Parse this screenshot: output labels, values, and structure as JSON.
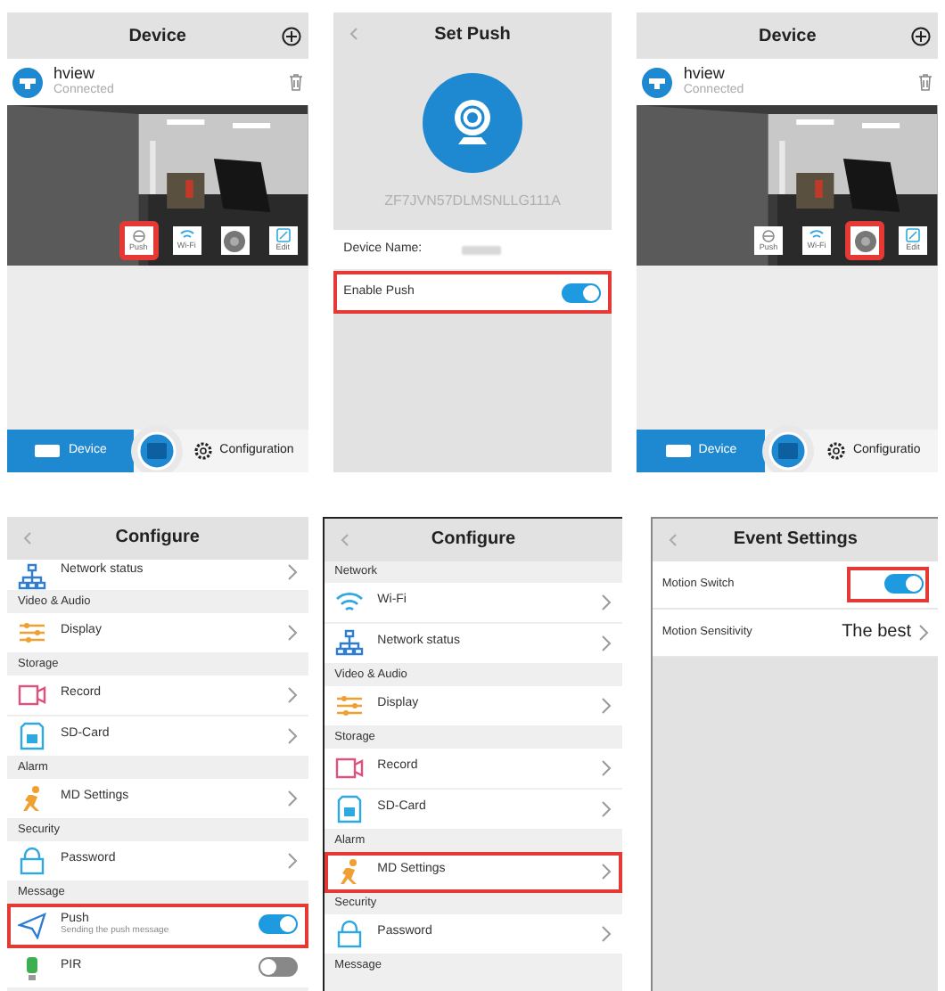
{
  "panels": [
    {
      "kind": "device",
      "title": "Device",
      "device": {
        "name": "hview",
        "status": "Connected"
      },
      "actions": [
        {
          "kind": "push",
          "label": "Push",
          "highlighted": true
        },
        {
          "kind": "wifi",
          "label": "Wi-Fi",
          "highlighted": false
        },
        {
          "kind": "settings",
          "highlighted": false
        },
        {
          "kind": "edit",
          "label": "Edit",
          "highlighted": false
        }
      ],
      "nav": [
        {
          "label": "Device",
          "selected": true
        },
        {
          "label": "Configuration",
          "selected": false
        }
      ]
    },
    {
      "kind": "set_push",
      "title": "Set Push",
      "device_id": "ZF7JVN57DLMSNLLG111A",
      "device_name_label": "Device Name:",
      "toggles": [
        {
          "label": "Enable Push",
          "on": true,
          "highlighted": true
        }
      ]
    },
    {
      "kind": "device",
      "title": "Device",
      "device": {
        "name": "hview",
        "status": "Connected"
      },
      "actions": [
        {
          "kind": "push",
          "label": "Push",
          "highlighted": false
        },
        {
          "kind": "wifi",
          "label": "Wi-Fi",
          "highlighted": false
        },
        {
          "kind": "settings",
          "highlighted": true
        },
        {
          "kind": "edit",
          "label": "Edit",
          "highlighted": false
        }
      ],
      "nav": [
        {
          "label": "Device",
          "selected": true
        },
        {
          "label": "Configuratio",
          "selected": false
        }
      ]
    },
    {
      "kind": "configure",
      "title": "Configure",
      "rows": [
        {
          "kind": "item",
          "label": "Network status",
          "highlighted": false
        },
        {
          "kind": "header",
          "label": "Video & Audio"
        },
        {
          "kind": "item",
          "label": "Display",
          "highlighted": false
        },
        {
          "kind": "header",
          "label": "Storage"
        },
        {
          "kind": "item",
          "label": "Record",
          "highlighted": false
        },
        {
          "kind": "item",
          "label": "SD-Card",
          "highlighted": false
        },
        {
          "kind": "header",
          "label": "Alarm"
        },
        {
          "kind": "item",
          "label": "MD Settings",
          "highlighted": false
        },
        {
          "kind": "header",
          "label": "Security"
        },
        {
          "kind": "item",
          "label": "Password",
          "highlighted": false
        },
        {
          "kind": "header",
          "label": "Message"
        },
        {
          "kind": "toggle",
          "label": "Push",
          "sublabel": "Sending the push message",
          "on": true,
          "highlighted": true
        },
        {
          "kind": "toggle",
          "label": "PIR",
          "on": false,
          "highlighted": false
        }
      ]
    },
    {
      "kind": "configure",
      "title": "Configure",
      "rows": [
        {
          "kind": "header",
          "label": "Network"
        },
        {
          "kind": "item",
          "label": "Wi-Fi",
          "highlighted": false
        },
        {
          "kind": "item",
          "label": "Network status",
          "highlighted": false
        },
        {
          "kind": "header",
          "label": "Video & Audio"
        },
        {
          "kind": "item",
          "label": "Display",
          "highlighted": false
        },
        {
          "kind": "header",
          "label": "Storage"
        },
        {
          "kind": "item",
          "label": "Record",
          "highlighted": false
        },
        {
          "kind": "item",
          "label": "SD-Card",
          "highlighted": false
        },
        {
          "kind": "header",
          "label": "Alarm"
        },
        {
          "kind": "item",
          "label": "MD Settings",
          "highlighted": true
        },
        {
          "kind": "header",
          "label": "Security"
        },
        {
          "kind": "item",
          "label": "Password",
          "highlighted": false
        },
        {
          "kind": "header",
          "label": "Message"
        }
      ]
    },
    {
      "kind": "event",
      "title": "Event Settings",
      "rows": [
        {
          "kind": "toggle",
          "label": "Motion Switch",
          "on": true,
          "highlighted": true
        },
        {
          "kind": "value",
          "label": "Motion Sensitivity",
          "value": "The best",
          "highlighted": false
        }
      ]
    }
  ]
}
